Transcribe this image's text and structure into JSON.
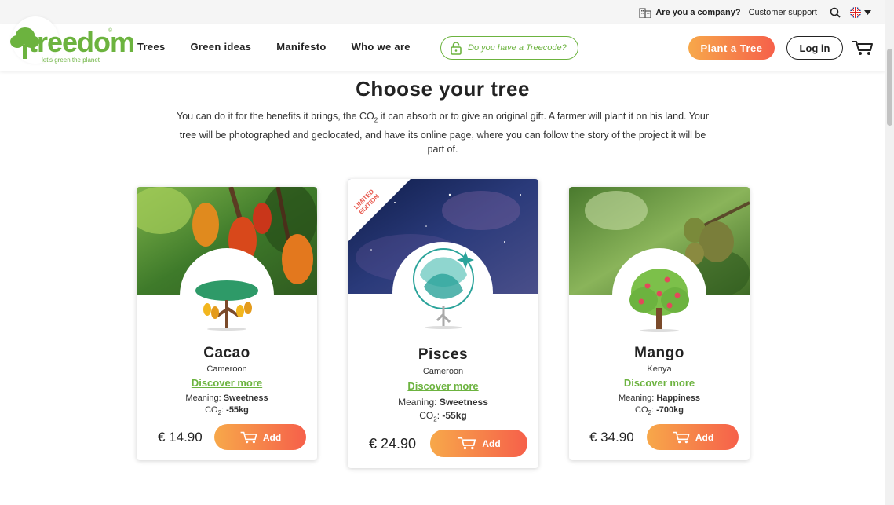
{
  "topbar": {
    "company": "Are you a company?",
    "support": "Customer support"
  },
  "logo": {
    "name": "treedom",
    "tagline": "let's green the planet",
    "reg": "®"
  },
  "nav": {
    "items": [
      "Trees",
      "Green ideas",
      "Manifesto",
      "Who we are"
    ]
  },
  "treecode": {
    "label": "Do you have a Treecode?"
  },
  "buttons": {
    "plant": "Plant a Tree",
    "login": "Log in"
  },
  "main": {
    "title": "Choose your tree",
    "intro_part1": "You can do it for the benefits it brings, the CO",
    "intro_sub": "2",
    "intro_part2": " it can absorb or to give an original gift. A farmer will plant it on his land. Your tree will be photographed and geolocated, and have its online page, where you can follow the story of the project it will be part of."
  },
  "cards": [
    {
      "name": "Cacao",
      "country": "Cameroon",
      "discover": "Discover more",
      "meaning_label": "Meaning: ",
      "meaning": "Sweetness",
      "co2_label": "CO",
      "co2_sub": "2",
      "co2_sep": ": ",
      "co2": "-55kg",
      "price": "€ 14.90",
      "add": "Add"
    },
    {
      "name": "Pisces",
      "country": "Cameroon",
      "discover": "Discover more",
      "meaning_label": "Meaning: ",
      "meaning": "Sweetness",
      "co2_label": "CO",
      "co2_sub": "2",
      "co2_sep": ": ",
      "co2": "-55kg",
      "price": "€ 24.90",
      "add": "Add",
      "ribbon": "LIMITED EDITION"
    },
    {
      "name": "Mango",
      "country": "Kenya",
      "discover": "Discover more",
      "meaning_label": "Meaning: ",
      "meaning": "Happiness",
      "co2_label": "CO",
      "co2_sub": "2",
      "co2_sep": ": ",
      "co2": "-700kg",
      "price": "€ 34.90",
      "add": "Add"
    }
  ],
  "colors": {
    "brand_green": "#6cb33f",
    "button_gradient_start": "#f7a84a",
    "button_gradient_end": "#f6604a"
  },
  "icons": [
    "building-icon",
    "search-icon",
    "uk-flag-icon",
    "caret-down-icon",
    "lock-icon",
    "cart-icon"
  ]
}
